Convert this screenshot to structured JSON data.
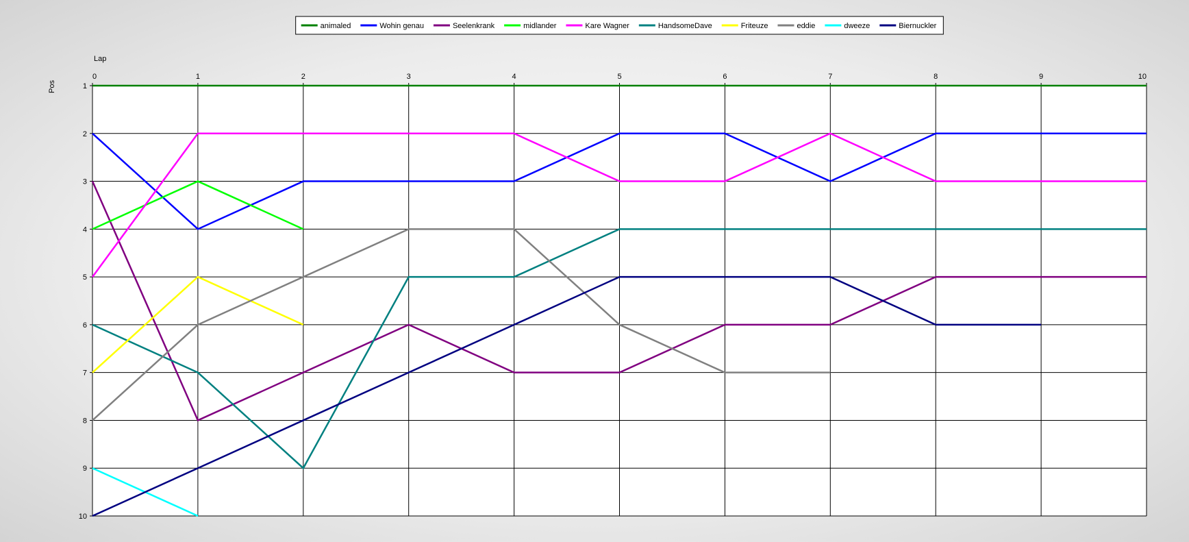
{
  "chart_data": {
    "type": "line",
    "xlabel": "Lap",
    "ylabel": "Pos",
    "x_ticks": [
      0,
      1,
      2,
      3,
      4,
      5,
      6,
      7,
      8,
      9,
      10
    ],
    "y_ticks": [
      1,
      2,
      3,
      4,
      5,
      6,
      7,
      8,
      9,
      10
    ],
    "xlim": [
      0,
      10
    ],
    "ylim": [
      1,
      10
    ],
    "y_inverted": true,
    "grid": true,
    "legend_position": "top-center",
    "series": [
      {
        "name": "animaled",
        "color": "#008000",
        "x": [
          0,
          1,
          2,
          3,
          4,
          5,
          6,
          7,
          8,
          9,
          10
        ],
        "y": [
          1,
          1,
          1,
          1,
          1,
          1,
          1,
          1,
          1,
          1,
          1
        ]
      },
      {
        "name": "Wohin genau",
        "color": "#0000FF",
        "x": [
          0,
          1,
          2,
          3,
          4,
          5,
          6,
          7,
          8,
          9,
          10
        ],
        "y": [
          2,
          4,
          3,
          3,
          3,
          2,
          2,
          3,
          2,
          2,
          2
        ]
      },
      {
        "name": "Seelenkrank",
        "color": "#800080",
        "x": [
          0,
          1,
          2,
          3,
          4,
          5,
          6,
          7,
          8,
          9,
          10
        ],
        "y": [
          3,
          8,
          7,
          6,
          7,
          7,
          6,
          6,
          5,
          5,
          5
        ]
      },
      {
        "name": "midlander",
        "color": "#00FF00",
        "x": [
          0,
          1,
          2
        ],
        "y": [
          4,
          3,
          4
        ]
      },
      {
        "name": "Kare Wagner",
        "color": "#FF00FF",
        "x": [
          0,
          1,
          2,
          3,
          4,
          5,
          6,
          7,
          8,
          9,
          10
        ],
        "y": [
          5,
          2,
          2,
          2,
          2,
          3,
          3,
          2,
          3,
          3,
          3
        ]
      },
      {
        "name": "HandsomeDave",
        "color": "#008080",
        "x": [
          0,
          1,
          2,
          3,
          4,
          5,
          6,
          7,
          8,
          9,
          10
        ],
        "y": [
          6,
          7,
          9,
          5,
          5,
          4,
          4,
          4,
          4,
          4,
          4
        ]
      },
      {
        "name": "Friteuze",
        "color": "#FFFF00",
        "x": [
          0,
          1,
          2
        ],
        "y": [
          7,
          5,
          6
        ]
      },
      {
        "name": "eddie",
        "color": "#808080",
        "x": [
          0,
          1,
          2,
          3,
          4,
          5,
          6,
          7
        ],
        "y": [
          8,
          6,
          5,
          4,
          4,
          6,
          7,
          7
        ]
      },
      {
        "name": "dweeze",
        "color": "#00FFFF",
        "x": [
          0,
          1
        ],
        "y": [
          9,
          10
        ]
      },
      {
        "name": "Biernuckler",
        "color": "#000080",
        "x": [
          0,
          1,
          2,
          3,
          4,
          5,
          6,
          7,
          8,
          9
        ],
        "y": [
          10,
          9,
          8,
          7,
          6,
          5,
          5,
          5,
          6,
          6
        ]
      }
    ]
  }
}
